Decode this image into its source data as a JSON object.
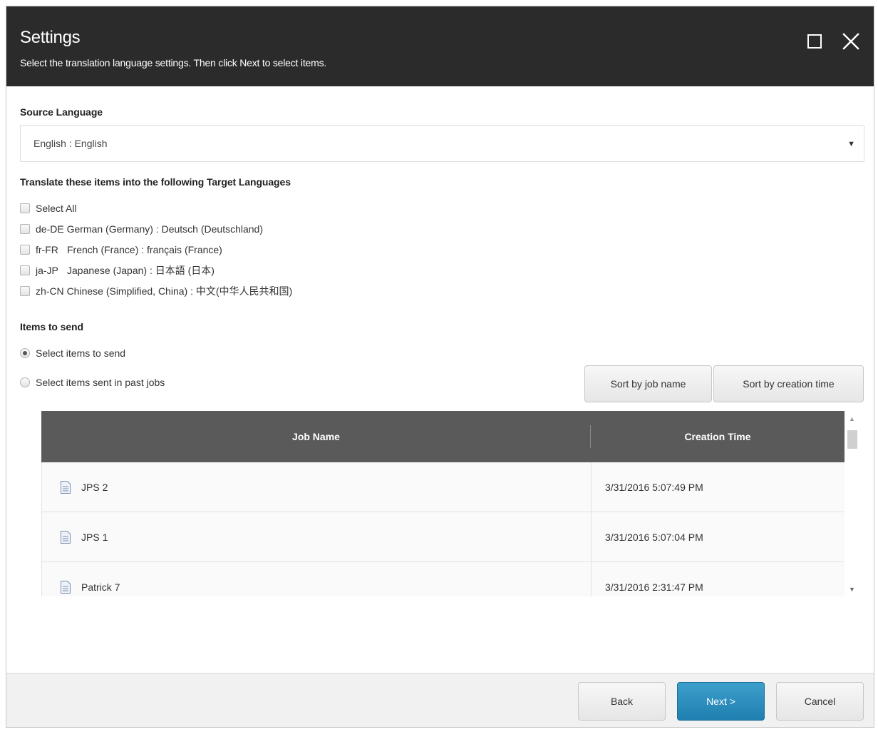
{
  "header": {
    "title": "Settings",
    "subtitle": "Select the translation language settings. Then click Next to select items."
  },
  "source_language": {
    "label": "Source Language",
    "selected": "English : English"
  },
  "target_languages": {
    "label": "Translate these items into the following Target Languages",
    "select_all": "Select All",
    "items": [
      {
        "code": "de-DE",
        "name": "German (Germany) : Deutsch (Deutschland)",
        "checked": false
      },
      {
        "code": "fr-FR",
        "name": "French (France) : français (France)",
        "checked": false
      },
      {
        "code": "ja-JP",
        "name": "Japanese (Japan) : 日本語 (日本)",
        "checked": false
      },
      {
        "code": "zh-CN",
        "name": "Chinese (Simplified, China) : 中文(中华人民共和国)",
        "checked": false
      }
    ]
  },
  "items_to_send": {
    "label": "Items to send",
    "options": [
      {
        "label": "Select items to send",
        "selected": true
      },
      {
        "label": "Select items sent in past jobs",
        "selected": false
      }
    ],
    "sort_by_job_name": "Sort by job name",
    "sort_by_creation_time": "Sort by creation time"
  },
  "jobs_table": {
    "columns": [
      "Job Name",
      "Creation Time"
    ],
    "rows": [
      {
        "job_name": "JPS 2",
        "creation_time": "3/31/2016 5:07:49 PM"
      },
      {
        "job_name": "JPS 1",
        "creation_time": "3/31/2016 5:07:04 PM"
      },
      {
        "job_name": "Patrick 7",
        "creation_time": "3/31/2016 2:31:47 PM"
      }
    ]
  },
  "footer": {
    "back": "Back",
    "next": "Next >",
    "cancel": "Cancel"
  },
  "colors": {
    "titlebar": "#2b2b2b",
    "table_header": "#5a5a5a",
    "primary_button": "#1f7fb0",
    "footer": "#f1f1f1"
  }
}
